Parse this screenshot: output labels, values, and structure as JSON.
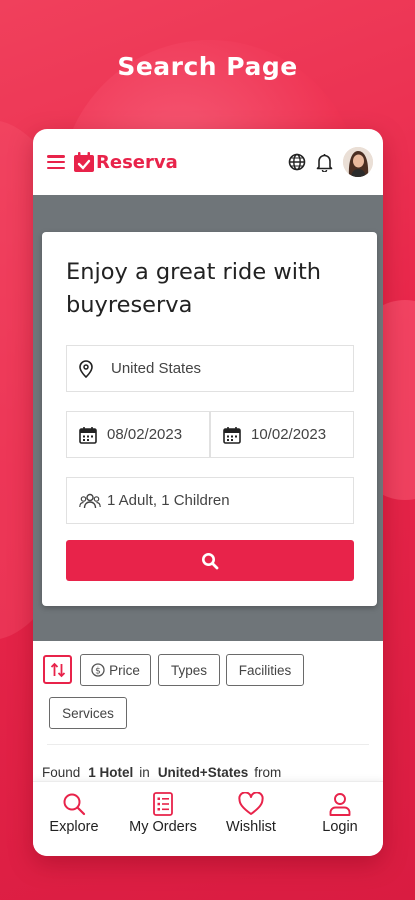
{
  "headline": "Search Page",
  "app": {
    "logo_text": "Reserva"
  },
  "hero": {
    "title": "Enjoy a great ride with buyreserva"
  },
  "search": {
    "location": "United States",
    "checkin": "08/02/2023",
    "checkout": "10/02/2023",
    "guests": "1 Adult, 1 Children"
  },
  "filters": {
    "chips": [
      "Price",
      "Types",
      "Facilities",
      "Services"
    ]
  },
  "results": {
    "found_label": "Found",
    "count": "1 Hotel",
    "in_label": "in",
    "location": "United+States",
    "from_label": "from"
  },
  "nav": {
    "items": [
      "Explore",
      "My Orders",
      "Wishlist",
      "Login"
    ]
  },
  "colors": {
    "accent": "#e8234a",
    "band": "#6f7579"
  },
  "icons": {
    "menu": "hamburger-icon",
    "logo": "calendar-check-icon",
    "globe": "globe-icon",
    "bell": "bell-icon",
    "location": "map-pin-icon",
    "calendar": "calendar-icon",
    "guests": "users-icon",
    "search": "search-icon",
    "sort": "sort-icon",
    "price": "dollar-circle-icon"
  }
}
